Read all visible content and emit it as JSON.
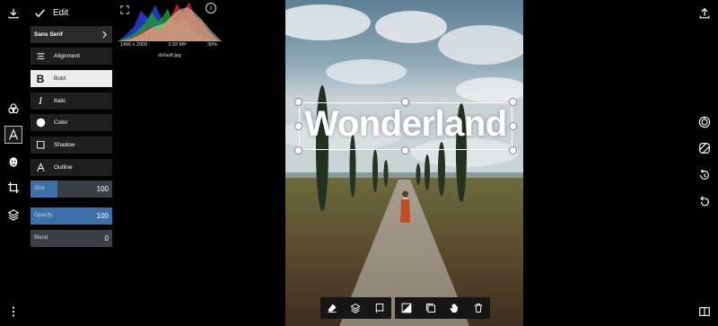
{
  "left_rail": {
    "icons": [
      "download-icon",
      "filters-icon",
      "text-icon",
      "face-icon",
      "crop-icon",
      "layers-icon",
      "more-icon"
    ],
    "active": "text-icon"
  },
  "panel": {
    "title": "Edit",
    "font_select": "Sans Serif",
    "options": [
      {
        "label": "Alignment",
        "icon": "align-icon",
        "selected": false
      },
      {
        "label": "Bold",
        "icon": "bold-icon",
        "selected": true
      },
      {
        "label": "Italic",
        "icon": "italic-icon",
        "selected": false
      },
      {
        "label": "Color",
        "icon": "color-swatch-icon",
        "selected": false
      },
      {
        "label": "Shadow",
        "icon": "shadow-icon",
        "selected": false
      },
      {
        "label": "Outline",
        "icon": "outline-icon",
        "selected": false
      }
    ],
    "sliders": [
      {
        "label": "Size",
        "value": "100",
        "fraction": 0.33
      },
      {
        "label": "Opacity",
        "value": "100",
        "fraction": 1.0
      },
      {
        "label": "Blend",
        "value": "0",
        "fraction": 0.0
      }
    ]
  },
  "histogram": {
    "dimensions": "1466 x 2000",
    "megapixels": "2.93 MP",
    "zoom": "30%",
    "filename": "default.jpg"
  },
  "canvas": {
    "text": "Wonderland"
  },
  "bottom_toolbar": {
    "group_a": [
      "eraser-icon",
      "layers-icon",
      "flag-icon"
    ],
    "group_b": [
      "adjust-icon",
      "duplicate-icon",
      "hand-icon",
      "trash-icon"
    ]
  },
  "right_rail": {
    "icons": [
      "upload-icon",
      "target-icon",
      "mask-icon",
      "history-icon",
      "undo-icon",
      "compare-icon"
    ]
  },
  "colors": {
    "background": "#000000",
    "panel_item": "#1e1e1e",
    "selected_item": "#ececec",
    "slider_fill": "#3d6fa8"
  }
}
